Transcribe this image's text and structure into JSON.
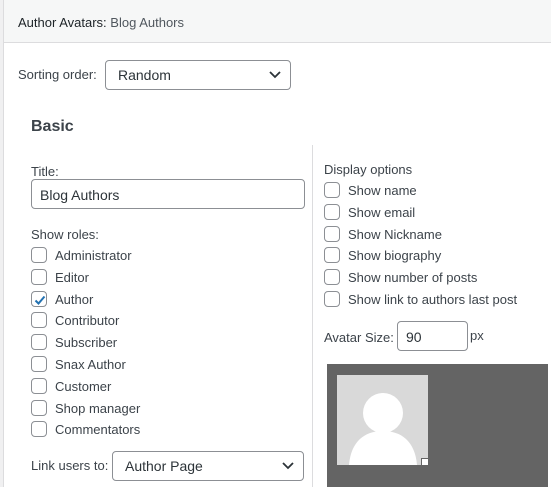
{
  "header": {
    "title": "Author Avatars:",
    "subtitle": "Blog Authors"
  },
  "sorting": {
    "label": "Sorting order:",
    "value": "Random"
  },
  "basic": {
    "title": "Basic"
  },
  "title_field": {
    "label": "Title:",
    "value": "Blog Authors"
  },
  "roles": {
    "label": "Show roles:",
    "items": [
      {
        "label": "Administrator",
        "checked": false
      },
      {
        "label": "Editor",
        "checked": false
      },
      {
        "label": "Author",
        "checked": true
      },
      {
        "label": "Contributor",
        "checked": false
      },
      {
        "label": "Subscriber",
        "checked": false
      },
      {
        "label": "Snax Author",
        "checked": false
      },
      {
        "label": "Customer",
        "checked": false
      },
      {
        "label": "Shop manager",
        "checked": false
      },
      {
        "label": "Commentators",
        "checked": false
      }
    ]
  },
  "link_users": {
    "label": "Link users to:",
    "value": "Author Page"
  },
  "display": {
    "label": "Display options",
    "items": [
      {
        "label": "Show name",
        "checked": false
      },
      {
        "label": "Show email",
        "checked": false
      },
      {
        "label": "Show Nickname",
        "checked": false
      },
      {
        "label": "Show biography",
        "checked": false
      },
      {
        "label": "Show number of posts",
        "checked": false
      },
      {
        "label": "Show link to authors last post",
        "checked": false
      }
    ]
  },
  "avatar_size": {
    "label": "Avatar Size:",
    "value": "90",
    "unit": "px"
  },
  "colors": {
    "accent": "#2271b1",
    "preview_bg": "#646464"
  },
  "icons": {
    "dropdown": "chevron-down-icon",
    "check": "checkmark-icon",
    "avatar": "user-silhouette-icon"
  }
}
